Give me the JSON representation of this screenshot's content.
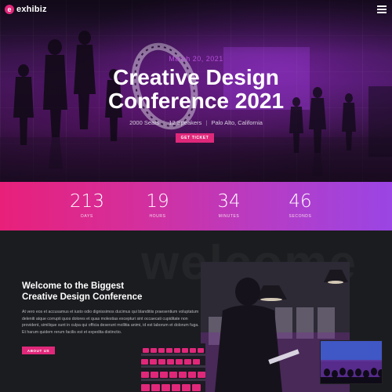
{
  "brand": {
    "logo_mark": "e",
    "name": "exhibiz"
  },
  "header": {
    "menu_icon": "hamburger-icon"
  },
  "hero": {
    "date": "March 20, 2021",
    "title_line1": "Creative Design",
    "title_line2": "Conference 2021",
    "meta": [
      "2000 Seats",
      "12 Speakers",
      "Palo Alto, California"
    ],
    "meta_separator": "|",
    "ticket_button": "GET TICKET"
  },
  "countdown": [
    {
      "value": "213",
      "label": "DAYS"
    },
    {
      "value": "19",
      "label": "HOURS"
    },
    {
      "value": "34",
      "label": "MINUTES"
    },
    {
      "value": "46",
      "label": "SECONDS"
    }
  ],
  "welcome": {
    "watermark": "welcome",
    "title_line1": "Welcome to the Biggest",
    "title_line2": "Creative Design Conference",
    "body": "At vero eos et accusamus et iusto odio dignissimos ducimus qui blanditiis praesentium voluptatum deleniti atque corrupti quos dolores et quas molestias excepturi sint occaecati cupiditate non provident, similique sunt in culpa qui officia deserunt mollitia animi, id est laborum et dolorum fuga. Et harum quidem rerum facilis est et expedita distinctio.",
    "about_button": "ABOUT US"
  },
  "colors": {
    "accent": "#e0287a",
    "gradient_start": "#e8207a",
    "gradient_end": "#9a45e4",
    "background": "#1b1c1f"
  }
}
